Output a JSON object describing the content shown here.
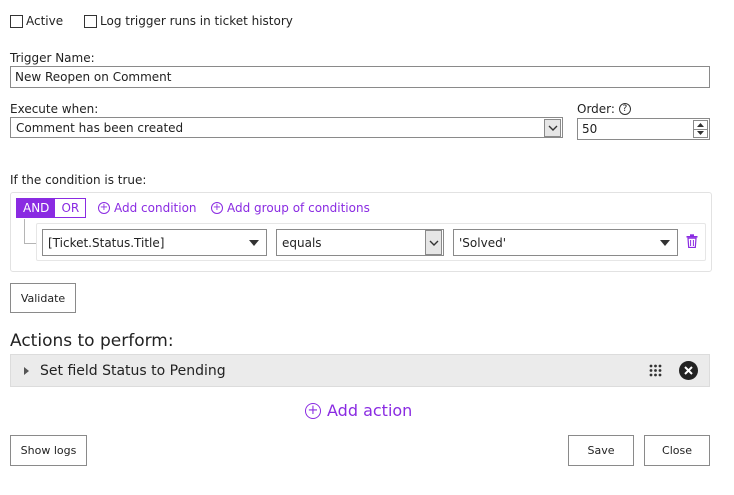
{
  "options": {
    "active_label": "Active",
    "log_label": "Log trigger runs in ticket history"
  },
  "trigger_name": {
    "label": "Trigger Name:",
    "value": "New Reopen on Comment"
  },
  "execute_when": {
    "label": "Execute when:",
    "value": "Comment has been created"
  },
  "order": {
    "label": "Order:",
    "value": "50"
  },
  "conditions": {
    "label": "If the condition is true:",
    "and_label": "AND",
    "or_label": "OR",
    "add_condition": "Add condition",
    "add_group": "Add group of conditions",
    "row": {
      "field": "[Ticket.Status.Title]",
      "operator": "equals",
      "value": "'Solved'"
    }
  },
  "validate_label": "Validate",
  "actions": {
    "heading": "Actions to perform:",
    "items": [
      {
        "label": "Set field Status to Pending"
      }
    ],
    "add_action": "Add action"
  },
  "footer": {
    "show_logs": "Show logs",
    "save": "Save",
    "close": "Close"
  },
  "colors": {
    "accent": "#8a2be2",
    "action_row_bg": "#ebebeb"
  }
}
